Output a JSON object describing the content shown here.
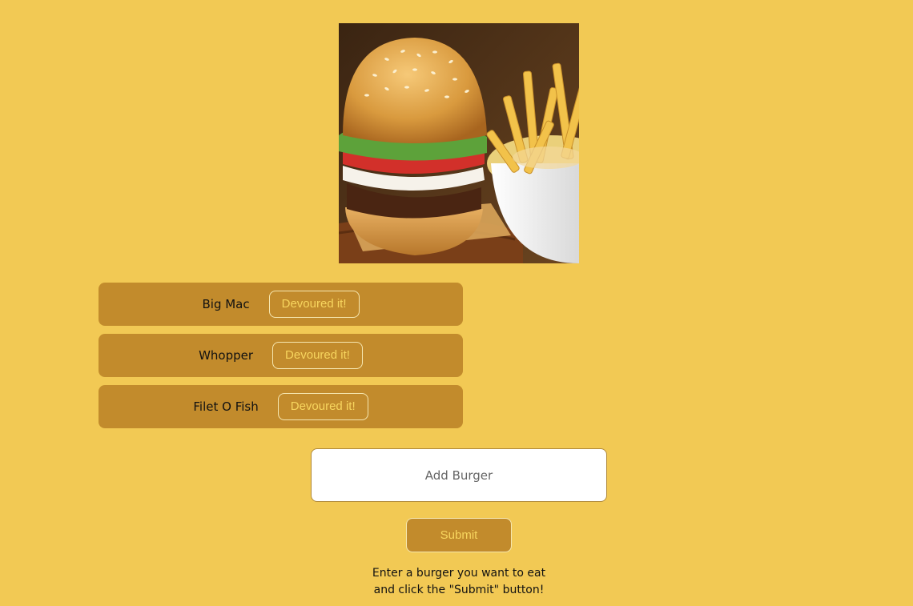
{
  "hero_image": {
    "alt": "burger-and-fries-photo"
  },
  "burgers": [
    {
      "name": "Big Mac",
      "button_label": "Devoured it!"
    },
    {
      "name": "Whopper",
      "button_label": "Devoured it!"
    },
    {
      "name": "Filet O Fish",
      "button_label": "Devoured it!"
    }
  ],
  "form": {
    "input_placeholder": "Add Burger",
    "input_value": "",
    "submit_label": "Submit"
  },
  "instructions": {
    "line1": "Enter a burger you want to eat",
    "line2": "and click the \"Submit\" button!"
  },
  "colors": {
    "background": "#F2C954",
    "card": "#C28B2C",
    "button_text": "#F7D55E"
  }
}
